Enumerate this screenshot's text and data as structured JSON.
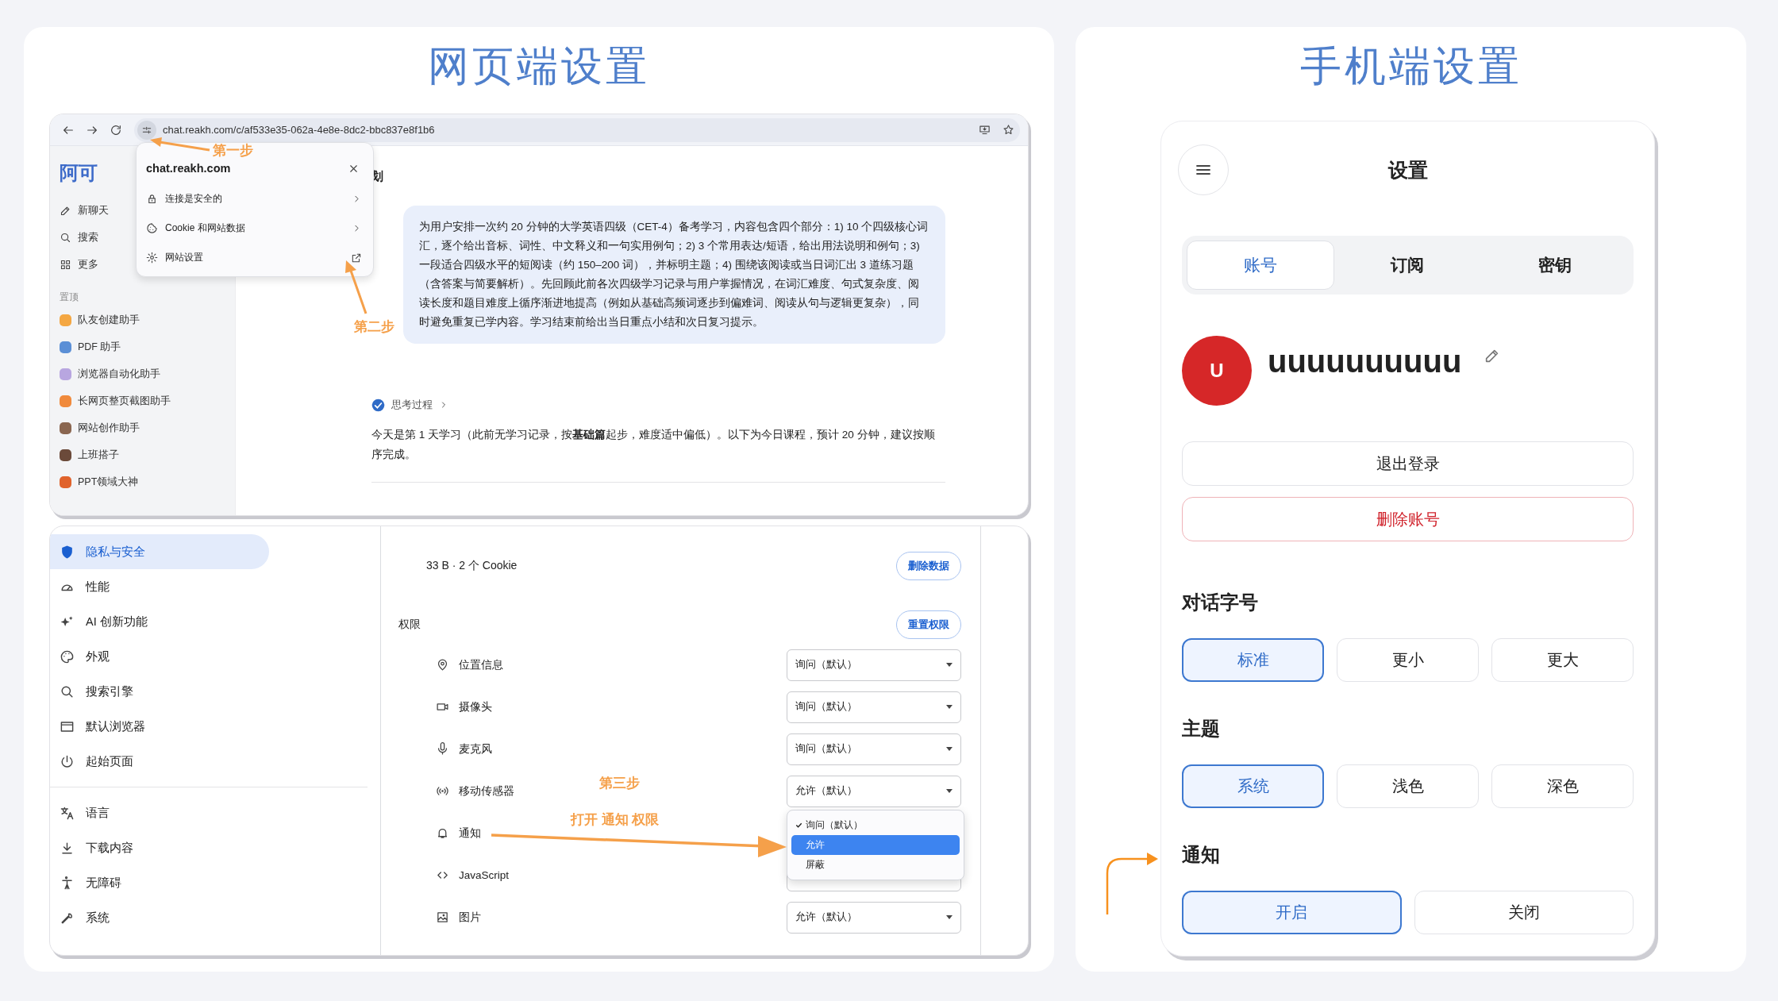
{
  "web_section": {
    "title": "网页端设置",
    "browser": {
      "url": "chat.reakh.com/c/af533e35-062a-4e8e-8dc2-bbc837e8f1b6",
      "logo": "阿可",
      "nav": [
        {
          "label": "新聊天"
        },
        {
          "label": "搜索"
        },
        {
          "label": "更多"
        }
      ],
      "pinned_heading": "置顶",
      "pinned": [
        {
          "label": "队友创建助手",
          "color": "#f4a742"
        },
        {
          "label": "PDF 助手",
          "color": "#5b8fd6"
        },
        {
          "label": "浏览器自动化助手",
          "color": "#b8a6e0"
        },
        {
          "label": "长网页整页截图助手",
          "color": "#f08a3c"
        },
        {
          "label": "网站创作助手",
          "color": "#8a6650"
        },
        {
          "label": "上班搭子",
          "color": "#6b4a3a"
        },
        {
          "label": "PPT领域大神",
          "color": "#e0632c"
        }
      ],
      "chat_title": "划",
      "prompt": "为用户安排一次约 20 分钟的大学英语四级（CET-4）备考学习，内容包含四个部分：1) 10 个四级核心词汇，逐个给出音标、词性、中文释义和一句实用例句；2) 3 个常用表达/短语，给出用法说明和例句；3) 一段适合四级水平的短阅读（约 150–200 词），并标明主题；4) 围绕该阅读或当日词汇出 3 道练习题（含答案与简要解析）。先回顾此前各次四级学习记录与用户掌握情况，在词汇难度、句式复杂度、阅读长度和题目难度上循序渐进地提高（例如从基础高频词逐步到偏难词、阅读从句与逻辑更复杂），同时避免重复已学内容。学习结束前给出当日重点小结和次日复习提示。",
      "thinking": "思考过程",
      "answer": "今天是第 1 天学习（此前无学习记录，按**基础篇**起步，难度适中偏低）。以下为今日课程，预计 20 分钟，建议按顺序完成。"
    },
    "site_popup": {
      "domain": "chat.reakh.com",
      "items": [
        {
          "label": "连接是安全的",
          "kind": "submenu"
        },
        {
          "label": "Cookie 和网站数据",
          "kind": "submenu"
        },
        {
          "label": "网站设置",
          "kind": "external"
        }
      ]
    },
    "settings": {
      "nav": [
        {
          "label": "隐私与安全",
          "selected": true
        },
        {
          "label": "性能",
          "selected": false
        },
        {
          "label": "AI 创新功能",
          "selected": false
        },
        {
          "label": "外观",
          "selected": false
        },
        {
          "label": "搜索引擎",
          "selected": false
        },
        {
          "label": "默认浏览器",
          "selected": false
        },
        {
          "label": "起始页面",
          "selected": false
        },
        {
          "label": "语言",
          "selected": false
        },
        {
          "label": "下载内容",
          "selected": false
        },
        {
          "label": "无障碍",
          "selected": false
        },
        {
          "label": "系统",
          "selected": false
        }
      ],
      "storage": "33 B · 2 个 Cookie",
      "delete_button": "删除数据",
      "permissions_heading": "权限",
      "reset_button": "重置权限",
      "permissions": [
        {
          "label": "位置信息",
          "value": "询问（默认）"
        },
        {
          "label": "摄像头",
          "value": "询问（默认）"
        },
        {
          "label": "麦克风",
          "value": "询问（默认）"
        },
        {
          "label": "移动传感器",
          "value": "允许（默认）"
        },
        {
          "label": "通知",
          "kind": "open"
        },
        {
          "label": "JavaScript"
        },
        {
          "label": "图片",
          "value": "允许（默认）"
        }
      ],
      "dropdown_options": [
        {
          "label": "询问（默认）",
          "checked": true,
          "selected": false
        },
        {
          "label": "允许",
          "checked": false,
          "selected": true
        },
        {
          "label": "屏蔽",
          "checked": false,
          "selected": false
        }
      ]
    },
    "annotations": [
      "第一步",
      "第二步",
      "第三步",
      "打开 通知 权限"
    ]
  },
  "mobile_section": {
    "title": "手机端设置",
    "header_title": "设置",
    "tabs": [
      {
        "label": "账号",
        "selected": true
      },
      {
        "label": "订阅",
        "selected": false
      },
      {
        "label": "密钥",
        "selected": false
      }
    ],
    "avatar_letter": "U",
    "username": "uuuuuuuuuu",
    "logout_button": "退出登录",
    "delete_button": "删除账号",
    "groups": [
      {
        "heading": "对话字号",
        "options": [
          {
            "label": "标准",
            "selected": true
          },
          {
            "label": "更小",
            "selected": false
          },
          {
            "label": "更大",
            "selected": false
          }
        ]
      },
      {
        "heading": "主题",
        "options": [
          {
            "label": "系统",
            "selected": true
          },
          {
            "label": "浅色",
            "selected": false
          },
          {
            "label": "深色",
            "selected": false
          }
        ]
      },
      {
        "heading": "通知",
        "options": [
          {
            "label": "开启",
            "selected": true
          },
          {
            "label": "关闭",
            "selected": false
          }
        ]
      }
    ]
  }
}
